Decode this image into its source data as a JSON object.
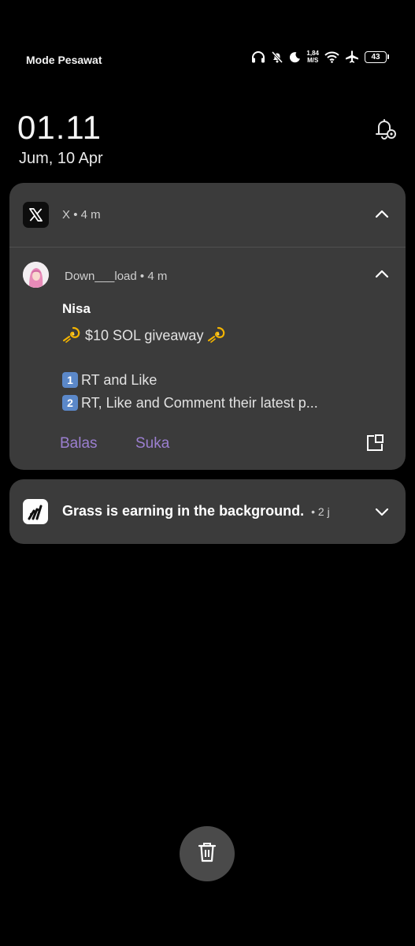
{
  "status_bar": {
    "mode_label": "Mode Pesawat",
    "net_speed_value": "1,84",
    "net_speed_unit": "M/S",
    "battery_level": "43",
    "icons": [
      "headphones-icon",
      "bell-muted-icon",
      "moon-icon",
      "wifi-icon",
      "airplane-icon",
      "battery-icon"
    ]
  },
  "lockscreen": {
    "time": "01.11",
    "date": "Jum, 10 Apr",
    "settings_icon": "bell-settings-icon"
  },
  "notifications": [
    {
      "app_name": "X",
      "app_time": "4 m",
      "sender": "Down___load",
      "sender_time": "4 m",
      "title": "Nisa",
      "line1_text": "$10 SOL giveaway",
      "line2_key": "1",
      "line2_text": "RT and Like",
      "line3_key": "2",
      "line3_text": "RT, Like and Comment their latest p...",
      "actions": {
        "reply": "Balas",
        "like": "Suka"
      },
      "accent_color": "#9b7fd0"
    },
    {
      "app_name": "Grass",
      "text": "Grass is earning in the background.",
      "time": "2 j"
    }
  ],
  "colors": {
    "background": "#000000",
    "card": "#3b3b3b",
    "action": "#9b7fd0"
  }
}
